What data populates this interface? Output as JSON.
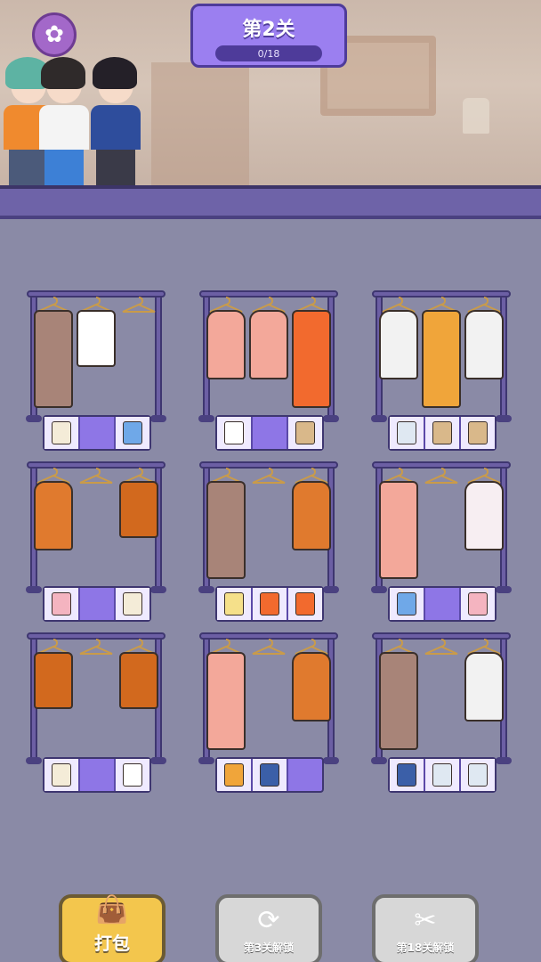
{
  "header": {
    "level_title": "第2关",
    "progress_text": "0/18",
    "settings_icon": "flower-gear-icon"
  },
  "colors": {
    "accent_purple": "#9b7ff0",
    "rack_purple": "#6c5fa4",
    "background": "#8a8aa6",
    "pack_button": "#f3c64d"
  },
  "racks": [
    {
      "garments": [
        {
          "type": "pants",
          "color": "#a88478"
        },
        {
          "type": "shorts",
          "color": "#ffffff"
        },
        {
          "type": "empty",
          "color": ""
        }
      ],
      "tray": [
        {
          "type": "skirt",
          "color": "#f4ecd8"
        },
        {
          "type": "empty",
          "color": ""
        },
        {
          "type": "skirt",
          "color": "#6fa8e8"
        }
      ]
    },
    {
      "garments": [
        {
          "type": "top",
          "color": "#f3a89a"
        },
        {
          "type": "top",
          "color": "#f3a89a"
        },
        {
          "type": "pants",
          "color": "#f26a2e"
        }
      ],
      "tray": [
        {
          "type": "shirt",
          "color": "#ffffff"
        },
        {
          "type": "empty",
          "color": ""
        },
        {
          "type": "jacket",
          "color": "#d9b88a"
        }
      ]
    },
    {
      "garments": [
        {
          "type": "top",
          "color": "#f2f2f2"
        },
        {
          "type": "overalls",
          "color": "#f0a53a"
        },
        {
          "type": "top",
          "color": "#f2f2f2"
        }
      ],
      "tray": [
        {
          "type": "shirt",
          "color": "#dfe8f2"
        },
        {
          "type": "jacket",
          "color": "#d9b88a"
        },
        {
          "type": "jacket",
          "color": "#d9b88a"
        }
      ]
    },
    {
      "garments": [
        {
          "type": "top",
          "color": "#e07a2e"
        },
        {
          "type": "empty",
          "color": ""
        },
        {
          "type": "shorts",
          "color": "#d2691e"
        }
      ],
      "tray": [
        {
          "type": "top",
          "color": "#f4b4c0"
        },
        {
          "type": "empty",
          "color": ""
        },
        {
          "type": "skirt",
          "color": "#f4ecd8"
        }
      ]
    },
    {
      "garments": [
        {
          "type": "pants",
          "color": "#a88478"
        },
        {
          "type": "empty",
          "color": ""
        },
        {
          "type": "top",
          "color": "#e07a2e"
        }
      ],
      "tray": [
        {
          "type": "top",
          "color": "#f5e08a"
        },
        {
          "type": "pants",
          "color": "#f26a2e"
        },
        {
          "type": "pants",
          "color": "#f26a2e"
        }
      ]
    },
    {
      "garments": [
        {
          "type": "skirt",
          "color": "#f3a89a"
        },
        {
          "type": "empty",
          "color": ""
        },
        {
          "type": "top",
          "color": "#f7eef2"
        }
      ],
      "tray": [
        {
          "type": "skirt",
          "color": "#6fa8e8"
        },
        {
          "type": "empty",
          "color": ""
        },
        {
          "type": "top",
          "color": "#f4b4c0"
        }
      ]
    },
    {
      "garments": [
        {
          "type": "shorts",
          "color": "#d2691e"
        },
        {
          "type": "empty",
          "color": ""
        },
        {
          "type": "shorts",
          "color": "#d2691e"
        }
      ],
      "tray": [
        {
          "type": "skirt",
          "color": "#f4ecd8"
        },
        {
          "type": "empty",
          "color": ""
        },
        {
          "type": "shorts",
          "color": "#ffffff"
        }
      ]
    },
    {
      "garments": [
        {
          "type": "skirt",
          "color": "#f3a89a"
        },
        {
          "type": "empty",
          "color": ""
        },
        {
          "type": "top",
          "color": "#e07a2e"
        }
      ],
      "tray": [
        {
          "type": "overalls",
          "color": "#f0a53a"
        },
        {
          "type": "pants",
          "color": "#3b5fa8"
        },
        {
          "type": "empty",
          "color": ""
        }
      ]
    },
    {
      "garments": [
        {
          "type": "pants",
          "color": "#a88478"
        },
        {
          "type": "empty",
          "color": ""
        },
        {
          "type": "top",
          "color": "#f2f2f2"
        }
      ],
      "tray": [
        {
          "type": "vest",
          "color": "#3b5fa8"
        },
        {
          "type": "shirt",
          "color": "#dfe8f2"
        },
        {
          "type": "shirt",
          "color": "#dfe8f2"
        }
      ]
    }
  ],
  "buttons": {
    "pack": {
      "label": "打包",
      "icon": "shopping-bag-icon"
    },
    "undo": {
      "label": "第3关解锁",
      "icon": "refresh-arrows-icon"
    },
    "cut": {
      "label": "第18关解锁",
      "icon": "scissors-icon"
    }
  }
}
